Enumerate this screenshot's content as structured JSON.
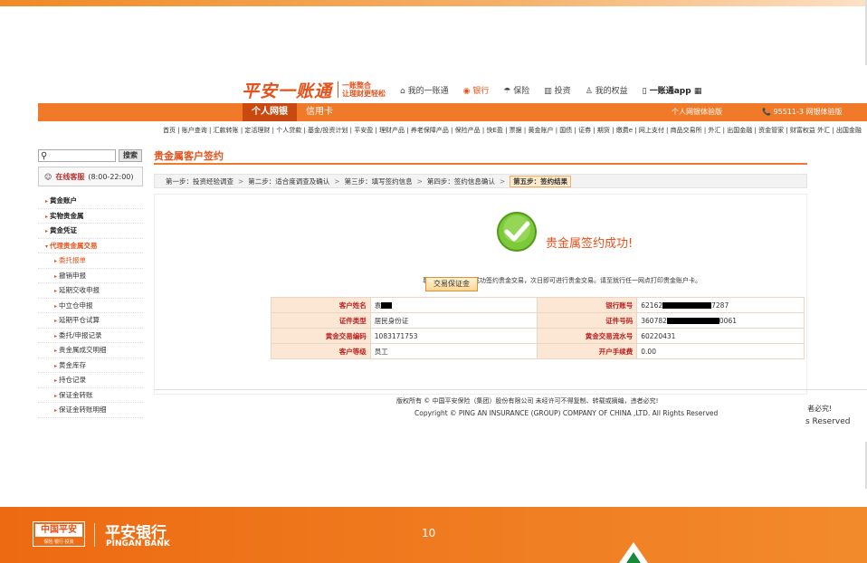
{
  "header": {
    "brand": "平安一账通",
    "slogan_line1": "一账整合",
    "slogan_line2": "让理财更轻松",
    "nav": [
      "我的一账通",
      "银行",
      "保险",
      "投资",
      "我的权益",
      "一账通app"
    ],
    "tabs": [
      "个人网银",
      "信用卡"
    ],
    "right_links": [
      "个人网银体验版",
      "95511-3 网银体验版"
    ],
    "subnav": "首页 | 账户查询 | 汇款转账 | 定活理财 | 个人贷款 | 基金/投资计划 | 平安盈 | 理财产品 | 养老保障产品 | 保险产品 | 快E盈 | 票据 | 黄金账户 | 国债 | 证券 | 期货 | 缴费e | 网上支付 | 商品交易所 | 外汇 | 出国金融 | 资金管家 | 财富权益",
    "subnav_highlight": "黄金账户",
    "subnav_overflow": "外汇 | 出国金融"
  },
  "sidebar": {
    "search_button": "搜索",
    "support_label": "在线客服",
    "support_hours": "(8:00-22:00)",
    "items": [
      {
        "label": "黄金账户",
        "level": "top"
      },
      {
        "label": "实物贵金属",
        "level": "top"
      },
      {
        "label": "黄金凭证",
        "level": "top"
      },
      {
        "label": "代理贵金属交易",
        "level": "open"
      },
      {
        "label": "委托报单",
        "level": "sub",
        "active": true
      },
      {
        "label": "撤销申报",
        "level": "sub"
      },
      {
        "label": "延期交收申报",
        "level": "sub"
      },
      {
        "label": "中立仓申报",
        "level": "sub"
      },
      {
        "label": "延期平仓试算",
        "level": "sub"
      },
      {
        "label": "委托/申报记录",
        "level": "sub"
      },
      {
        "label": "贵金属成交明细",
        "level": "sub"
      },
      {
        "label": "黄金库存",
        "level": "sub"
      },
      {
        "label": "持仓记录",
        "level": "sub"
      },
      {
        "label": "保证金转账",
        "level": "sub"
      },
      {
        "label": "保证金转账明细",
        "level": "sub"
      }
    ]
  },
  "main": {
    "title": "贵金属客户签约",
    "steps": [
      "第一步：投资经验调查",
      "第二步：适合度调查及确认",
      "第三步：填写签约信息",
      "第四步：签约信息确认",
      "第五步：签约结果"
    ],
    "step_separator": ">",
    "success_message": "贵金属签约成功!",
    "notice": "尊敬的客户，您已成功签约贵金交易，次日即可进行贵金交易。请至就行任一网点打印贵金账户卡。",
    "info_rows": [
      {
        "l1": "客户姓名",
        "v1": "袁",
        "l2": "银行账号",
        "v2a": "62162",
        "v2b": "7287"
      },
      {
        "l1": "证件类型",
        "v1": "居民身份证",
        "l2": "证件号码",
        "v2a": "360782",
        "v2b": "0061"
      },
      {
        "l1": "黄金交易编码",
        "v1": "1083171753",
        "l2": "黄金交易流水号",
        "v2a": "60220431",
        "v2b": ""
      },
      {
        "l1": "客户等级",
        "v1": "员工",
        "l2": "开户手续费",
        "v2a": "0.00",
        "v2b": ""
      }
    ],
    "action_button": "交易保证金"
  },
  "footer": {
    "copyright_cn": "版权所有 © 中国平安保险（集团）股份有限公司 未经许可不得复制、转载或摘编，违者必究!",
    "copyright_en": "Copyright © PING AN INSURANCE (GROUP) COMPANY OF CHINA ,LTD. All Rights Reserved",
    "cutoff1": "者必究!",
    "cutoff2": "s Reserved",
    "logo_text": "中国平安",
    "logo_sub": "保险·银行·投资",
    "bank_name": "平安银行",
    "bank_name_en": "PINGAN BANK",
    "page_number": "10"
  },
  "colors": {
    "accent": "#f07a2a",
    "brand": "#e8501a",
    "success": "#6cbf2a"
  }
}
